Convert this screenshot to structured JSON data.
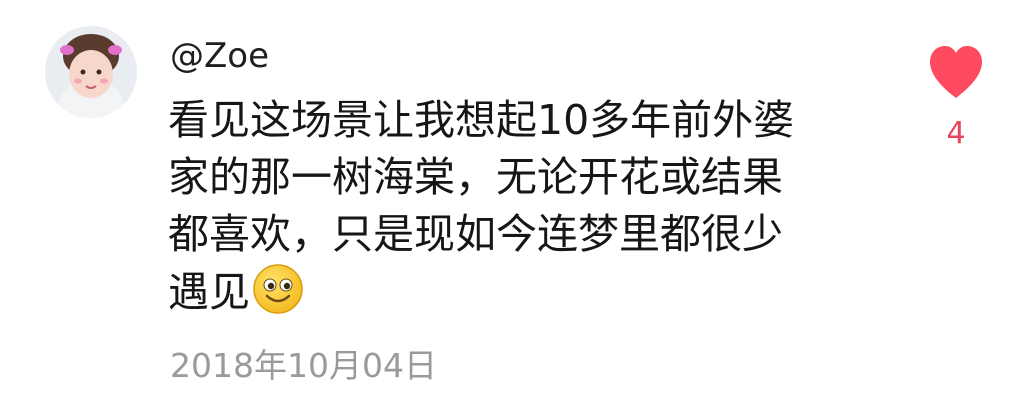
{
  "comment": {
    "username": "@Zoe",
    "body_lines": [
      "看见这场景让我想起10多年前外婆",
      "家的那一树海棠，无论开花或结果",
      "都喜欢，只是现如今连梦里都很少",
      "遇见"
    ],
    "emoji": "smiling-face-icon",
    "timestamp": "2018年10月04日",
    "likes": "4",
    "like_icon": "heart-icon",
    "colors": {
      "like": "#ff4a5f",
      "like_count": "#e8455c",
      "timestamp": "#9a9a9a",
      "text": "#161616"
    }
  }
}
